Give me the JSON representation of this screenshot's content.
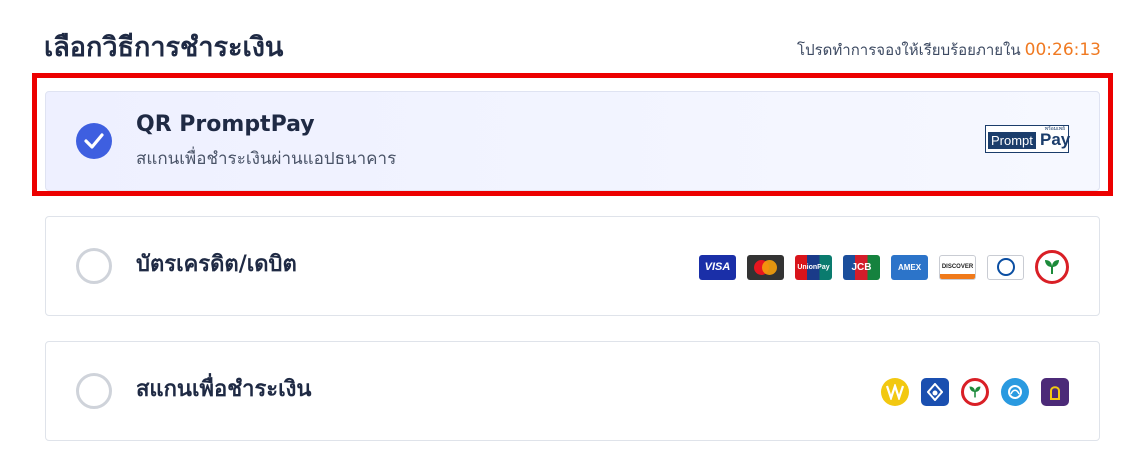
{
  "header": {
    "title": "เลือกวิธีการชำระเงิน",
    "countdown_label": "โปรดทำการจองให้เรียบร้อยภายใน",
    "countdown_time": "00:26:13"
  },
  "options": [
    {
      "title": "QR PromptPay",
      "subtitle": "สแกนเพื่อชำระเงินผ่านแอปธนาคาร",
      "selected": true,
      "logo": {
        "name": "promptpay-logo",
        "top_text": "พร้อมเพย์",
        "left_text": "Prompt",
        "right_text": "Pay"
      }
    },
    {
      "title": "บัตรเครดิต/เดบิต",
      "selected": false,
      "card_logos": [
        {
          "name": "visa-logo",
          "text": "VISA"
        },
        {
          "name": "mastercard-logo",
          "text": ""
        },
        {
          "name": "unionpay-logo",
          "text": "UnionPay"
        },
        {
          "name": "jcb-logo",
          "text": "JCB"
        },
        {
          "name": "amex-logo",
          "text": "AMEX"
        },
        {
          "name": "discover-logo",
          "text": "DISCOVER"
        },
        {
          "name": "diners-club-logo",
          "text": ""
        },
        {
          "name": "kasikorn-bank-logo",
          "text": ""
        }
      ]
    },
    {
      "title": "สแกนเพื่อชำระเงิน",
      "selected": false,
      "bank_logos": [
        {
          "name": "krungthai-bank-logo"
        },
        {
          "name": "bangkok-bank-logo"
        },
        {
          "name": "kasikorn-bank-logo"
        },
        {
          "name": "siam-commercial-bank-logo"
        },
        {
          "name": "krungsri-bank-logo"
        }
      ]
    }
  ],
  "colors": {
    "accent": "#3e5fe0",
    "countdown": "#f07a22",
    "highlight": "#ec0000",
    "text_dark": "#1f2a44"
  }
}
